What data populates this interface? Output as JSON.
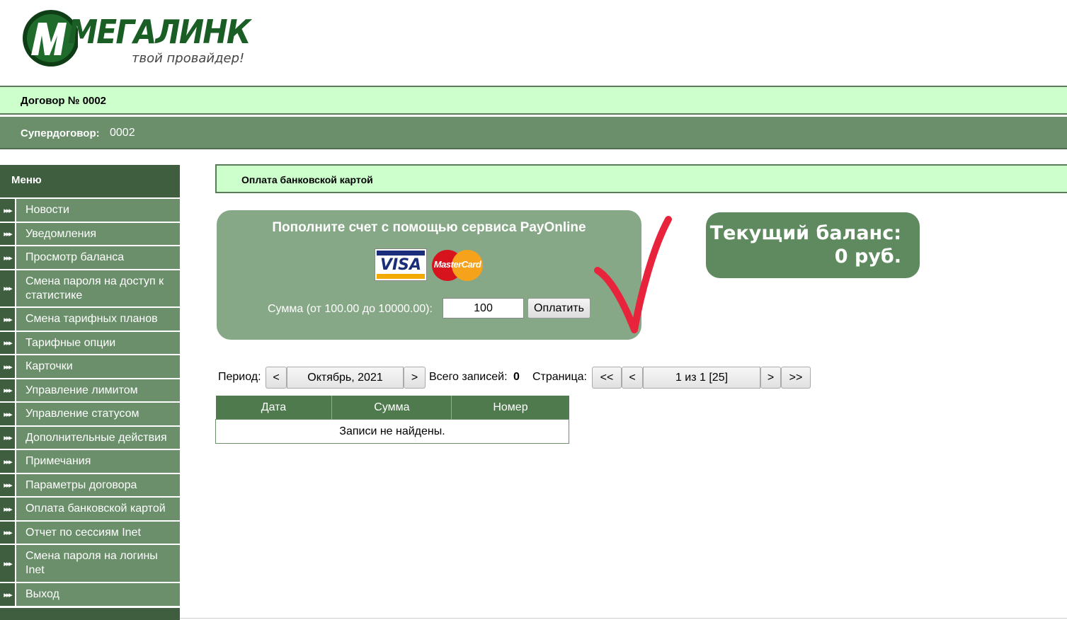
{
  "logo": {
    "name": "МЕГАЛИНК",
    "tagline": "твой провайдер!"
  },
  "header": {
    "contract_label": "Договор № 0002",
    "supercontract_label": "Супердоговор:",
    "supercontract_value": "0002"
  },
  "sidebar": {
    "title": "Меню",
    "items": [
      {
        "label": "Новости"
      },
      {
        "label": "Уведомления"
      },
      {
        "label": "Просмотр баланса"
      },
      {
        "label": "Смена пароля на доступ к статистике"
      },
      {
        "label": "Смена тарифных планов"
      },
      {
        "label": "Тарифные опции"
      },
      {
        "label": "Карточки"
      },
      {
        "label": "Управление лимитом"
      },
      {
        "label": "Управление статусом"
      },
      {
        "label": "Дополнительные действия"
      },
      {
        "label": "Примечания"
      },
      {
        "label": "Параметры договора"
      },
      {
        "label": "Оплата банковской картой"
      },
      {
        "label": "Отчет по сессиям Inet"
      },
      {
        "label": "Смена пароля на логины Inet"
      },
      {
        "label": "Выход"
      }
    ]
  },
  "main": {
    "section_title": "Оплата банковской картой",
    "payment": {
      "title": "Пополните счет с помощью сервиса PayOnline",
      "visa_text": "VISA",
      "mastercard_text": "MasterCard",
      "sum_label": "Сумма (от 100.00 до 10000.00):",
      "sum_value": "100",
      "pay_button": "Оплатить"
    },
    "balance": {
      "line1": "Текущий баланс:",
      "line2": "0 руб."
    },
    "period": {
      "label": "Период:",
      "prev": "<",
      "value": "Октябрь, 2021",
      "next": ">",
      "total_label": "Всего записей:",
      "total_value": "0",
      "page_label": "Страница:",
      "first": "<<",
      "prev_page": "<",
      "page_value": "1 из 1 [25]",
      "next_page": ">",
      "last": ">>"
    },
    "table": {
      "columns": [
        "Дата",
        "Сумма",
        "Номер"
      ],
      "empty_text": "Записи не найдены."
    }
  },
  "colors": {
    "light_green": "#ccffcc",
    "mid_green": "#6a8f6a",
    "dark_green": "#3f5e3f",
    "panel_green": "#86a886",
    "balance_green": "#5f8a5f",
    "check_red": "#e8243c"
  }
}
